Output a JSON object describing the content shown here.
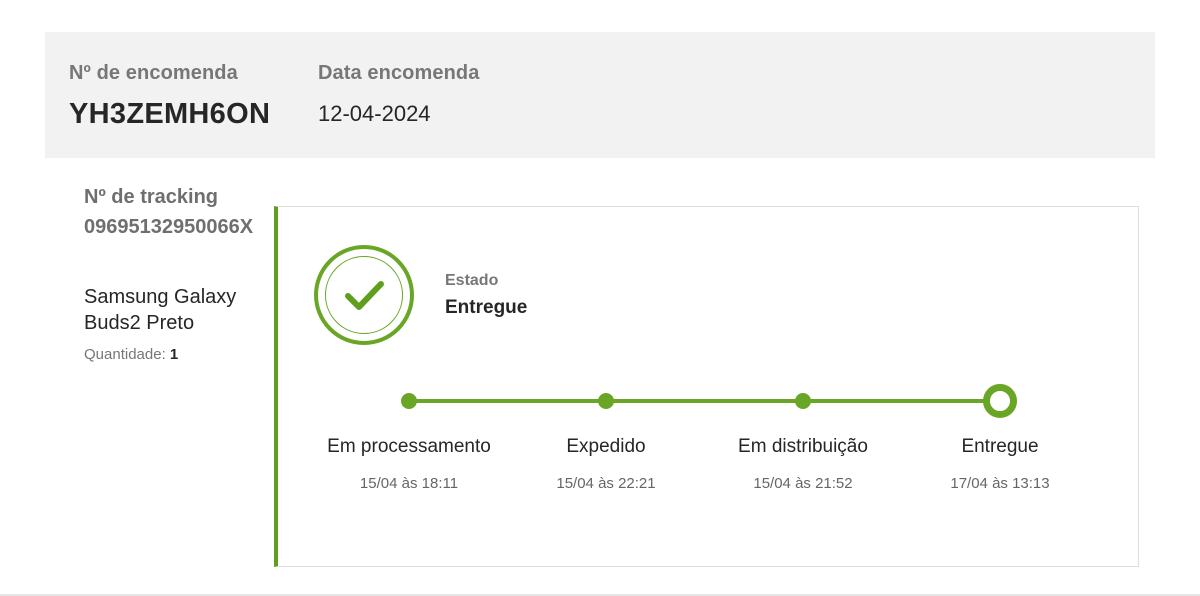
{
  "order": {
    "number_label": "Nº de encomenda",
    "number": "YH3ZEMH6ON",
    "date_label": "Data encomenda",
    "date": "12-04-2024"
  },
  "tracking": {
    "label": "Nº de tracking",
    "number": "09695132950066X"
  },
  "product": {
    "name": "Samsung Galaxy Buds2 Preto",
    "quantity_label": "Quantidade:",
    "quantity": "1"
  },
  "status": {
    "label": "Estado",
    "value": "Entregue",
    "icon": "check-icon",
    "accent_color": "#6aa625"
  },
  "timeline": {
    "steps": [
      {
        "label": "Em processamento",
        "time": "15/04 às 18:11"
      },
      {
        "label": "Expedido",
        "time": "15/04 às 22:21"
      },
      {
        "label": "Em distribuição",
        "time": "15/04 às 21:52"
      },
      {
        "label": "Entregue",
        "time": "17/04 às 13:13"
      }
    ]
  }
}
